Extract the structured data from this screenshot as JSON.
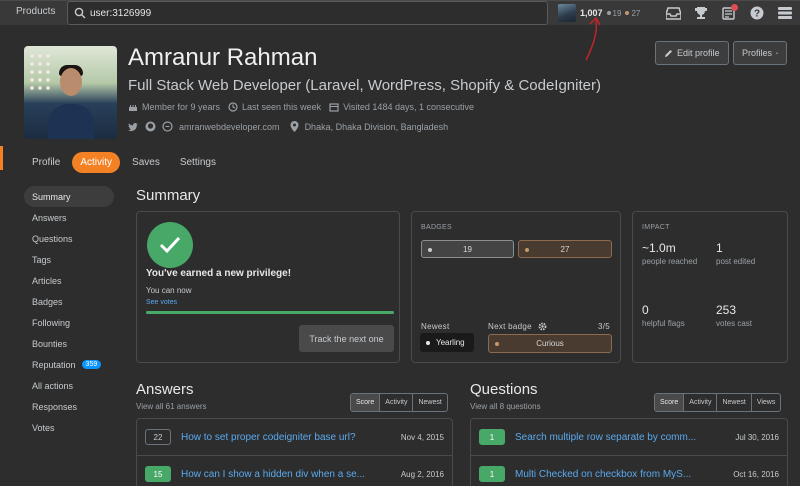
{
  "topbar": {
    "products_label": "Products",
    "search_value": "user:3126999",
    "reputation": "1,007",
    "silver_count": "19",
    "bronze_count": "27"
  },
  "profile": {
    "name": "Amranur Rahman",
    "title": "Full Stack Web Developer (Laravel, WordPress, Shopify & CodeIgniter)",
    "member_for": "Member for 9 years",
    "last_seen": "Last seen this week",
    "visited": "Visited 1484 days, 1 consecutive",
    "website": "amranwebdeveloper.com",
    "location": "Dhaka, Dhaka Division, Bangladesh",
    "edit_profile_label": "Edit profile",
    "profiles_label": "Profiles"
  },
  "tabs": [
    {
      "label": "Profile"
    },
    {
      "label": "Activity"
    },
    {
      "label": "Saves"
    },
    {
      "label": "Settings"
    }
  ],
  "sidebar": {
    "items": [
      {
        "label": "Summary"
      },
      {
        "label": "Answers"
      },
      {
        "label": "Questions"
      },
      {
        "label": "Tags"
      },
      {
        "label": "Articles"
      },
      {
        "label": "Badges"
      },
      {
        "label": "Following"
      },
      {
        "label": "Bounties"
      },
      {
        "label": "Reputation",
        "badge": "359"
      },
      {
        "label": "All actions"
      },
      {
        "label": "Responses"
      },
      {
        "label": "Votes"
      }
    ]
  },
  "summary": {
    "heading": "Summary",
    "privilege_title": "You've earned a new privilege!",
    "privilege_sub": "You can now",
    "privilege_link": "See votes",
    "privilege_progress": 1.0,
    "track_button": "Track the next one"
  },
  "badges": {
    "label": "BADGES",
    "silver": "19",
    "bronze": "27",
    "newest_label": "Newest",
    "newest_badge": "Yearling",
    "next_label": "Next badge",
    "next_progress": "3/5",
    "next_badge": "Curious"
  },
  "impact": {
    "label": "IMPACT",
    "people_reached": "~1.0m",
    "people_reached_label": "people reached",
    "posts_edited": "1",
    "posts_edited_label": "post edited",
    "helpful_flags": "0",
    "helpful_flags_label": "helpful flags",
    "votes_cast": "253",
    "votes_cast_label": "votes cast"
  },
  "answers": {
    "heading": "Answers",
    "view_all": "View all 61 answers",
    "filters": [
      "Score",
      "Activity",
      "Newest"
    ],
    "rows": [
      {
        "score": "22",
        "title": "How to set proper codeigniter base url?",
        "date": "Nov 4, 2015"
      },
      {
        "score": "15",
        "title": "How can I show a hidden div when a se...",
        "date": "Aug 2, 2016"
      }
    ]
  },
  "questions": {
    "heading": "Questions",
    "view_all": "View all 8 questions",
    "filters": [
      "Score",
      "Activity",
      "Newest",
      "Views"
    ],
    "rows": [
      {
        "score": "1",
        "title": "Search multiple row separate by comm...",
        "date": "Jul 30, 2016"
      },
      {
        "score": "1",
        "title": "Multi Checked on checkbox from MyS...",
        "date": "Oct 16, 2016"
      }
    ]
  },
  "colors": {
    "accent": "#f48225",
    "success": "#48a868",
    "link": "#5aa9ef",
    "silver": "#9aa0a6",
    "bronze": "#c4976b",
    "annotation_arrow": "#c0252a"
  }
}
